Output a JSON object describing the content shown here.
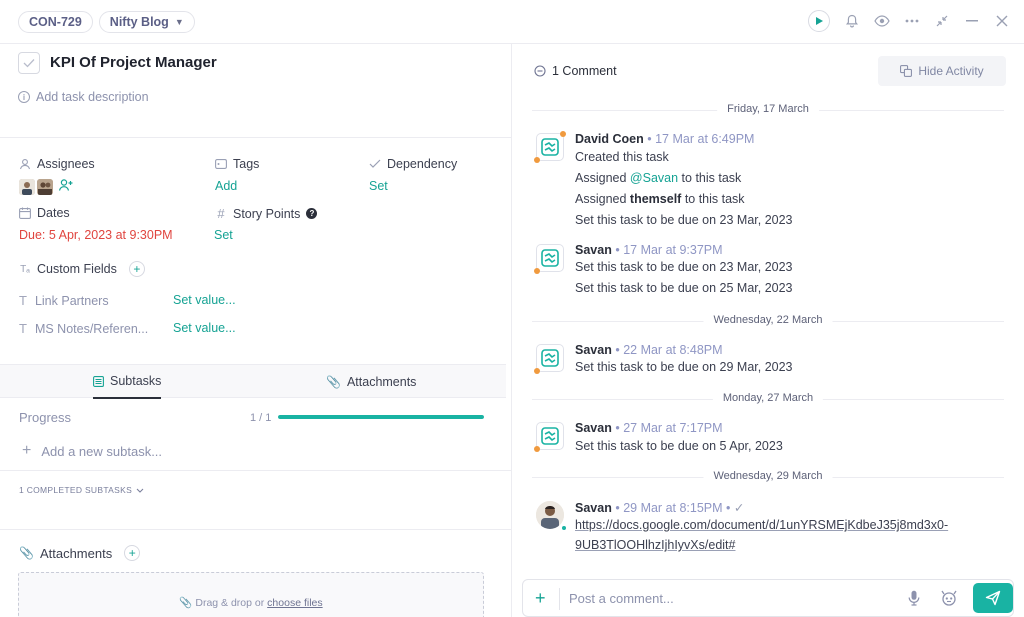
{
  "header": {
    "task_id": "CON-729",
    "project": "Nifty Blog"
  },
  "task": {
    "title": "KPI Of Project Manager",
    "add_description": "Add task description"
  },
  "fields": {
    "assignees_label": "Assignees",
    "tags_label": "Tags",
    "tags_value": "Add",
    "dependency_label": "Dependency",
    "dependency_value": "Set",
    "dates_label": "Dates",
    "due": "Due: 5 Apr, 2023 at 9:30PM",
    "story_points_label": "Story Points",
    "story_points_value": "Set",
    "custom_fields_label": "Custom Fields",
    "custom": [
      {
        "label": "Link Partners",
        "value": "Set value..."
      },
      {
        "label": "MS Notes/Referen...",
        "value": "Set value..."
      }
    ]
  },
  "tabs": {
    "subtasks": "Subtasks",
    "attachments": "Attachments"
  },
  "subtasks": {
    "progress_label": "Progress",
    "progress_count": "1 / 1",
    "progress_fraction": 1.0,
    "add_placeholder": "Add a new subtask...",
    "completed_label": "1 COMPLETED SUBTASKS"
  },
  "attachments": {
    "title": "Attachments",
    "drop_text": "Drag & drop or",
    "choose_files": "choose files"
  },
  "activity": {
    "comment_count": "1 Comment",
    "hide_activity": "Hide Activity",
    "dates": [
      "Friday, 17 March",
      "Wednesday, 22 March",
      "Monday, 27 March",
      "Wednesday, 29 March"
    ],
    "entries": [
      {
        "author": "David Coen",
        "time": "17 Mar at 6:49PM",
        "lines": [
          "Created this task",
          "Set this task to be due on 23 Mar, 2023"
        ],
        "assigned_pre": "Assigned",
        "assigned_mention": "@Savan",
        "assigned_post": "to this task",
        "assigned2_pre": "Assigned",
        "assigned2_bold": "themself",
        "assigned2_post": "to this task"
      },
      {
        "author": "Savan",
        "time": "17 Mar at 9:37PM",
        "lines": [
          "Set this task to be due on 23 Mar, 2023",
          "Set this task to be due on 25 Mar, 2023"
        ]
      },
      {
        "author": "Savan",
        "time": "22 Mar at 8:48PM",
        "lines": [
          "Set this task to be due on 29 Mar, 2023"
        ]
      },
      {
        "author": "Savan",
        "time": "27 Mar at 7:17PM",
        "lines": [
          "Set this task to be due on 5 Apr, 2023"
        ]
      }
    ],
    "comment": {
      "author": "Savan",
      "time": "29 Mar at 8:15PM",
      "link_line1": "https://docs.google.com/document/d/1unYRSMEjKdbeJ35j8md3x0-",
      "link_line2": "9UB3TlOOHlhzIjhIyvXs/edit#"
    },
    "composer_placeholder": "Post a comment..."
  },
  "colors": {
    "accent": "#19b3a3",
    "due_red": "#e0453f",
    "activity_orange": "#f09a3e"
  }
}
